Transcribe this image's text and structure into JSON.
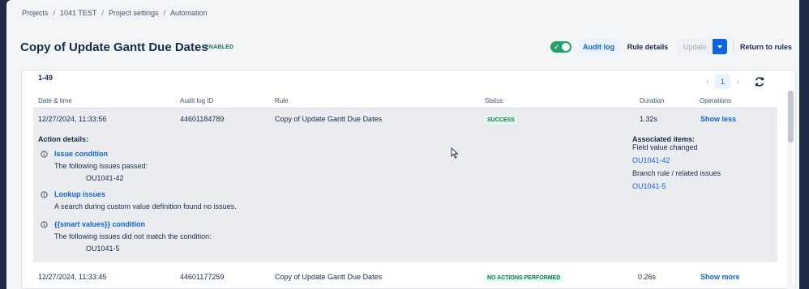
{
  "breadcrumb": {
    "items": [
      "Projects",
      "1041 TEST",
      "Project settings",
      "Automation"
    ],
    "separator": "/"
  },
  "header": {
    "title": "Copy of Update Gantt Due Dates",
    "status": "ENABLED",
    "toggle_on": true,
    "audit_log": "Audit log",
    "rule_details": "Rule details",
    "update": "Update",
    "return_to_rules": "Return to rules"
  },
  "table": {
    "range": "1-49",
    "page": "1",
    "columns": [
      "Date & time",
      "Audit log ID",
      "Rule",
      "Status",
      "Duration",
      "Operations"
    ],
    "rows": [
      {
        "date": "12/27/2024, 11:33:56",
        "id": "44601184789",
        "rule": "Copy of Update Gantt Due Dates",
        "status": "SUCCESS",
        "duration": "1.32s",
        "operation": "Show less"
      },
      {
        "date": "12/27/2024, 11:33:45",
        "id": "44601177259",
        "rule": "Copy of Update Gantt Due Dates",
        "status": "NO ACTIONS PERFORMED",
        "duration": "0.26s",
        "operation": "Show more"
      }
    ]
  },
  "details": {
    "action_title": "Action details:",
    "actions": [
      {
        "name": "Issue condition",
        "desc": "The following issues passed:",
        "issue": "OU1041-42"
      },
      {
        "name": "Lookup issues",
        "desc": "A search during custom value definition found no issues.",
        "issue": ""
      },
      {
        "name": "{{smart values}} condition",
        "desc": "The following issues did not match the condition:",
        "issue": "OU1041-5"
      }
    ],
    "associated_title": "Associated items:",
    "associated": [
      {
        "label": "Field value changed",
        "issue": "OU1041-42"
      },
      {
        "label": "Branch rule / related issues",
        "issue": "OU1041-5"
      }
    ]
  },
  "colors": {
    "accent": "#0c66e4",
    "success": "#216e4e",
    "toggle": "#22a06b"
  },
  "icons": [
    "info-icon",
    "refresh-icon",
    "chevron-left-icon",
    "chevron-right-icon",
    "chevron-down-icon",
    "check-icon",
    "mouse-cursor-icon"
  ]
}
